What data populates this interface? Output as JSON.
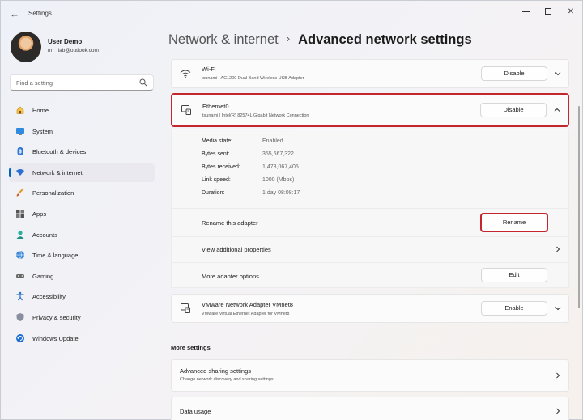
{
  "window": {
    "title": "Settings"
  },
  "user": {
    "name": "User Demo",
    "email": "m__lab@outlook.com"
  },
  "search": {
    "placeholder": "Find a setting"
  },
  "nav": {
    "items": [
      {
        "label": "Home",
        "icon": "home-icon"
      },
      {
        "label": "System",
        "icon": "system-icon"
      },
      {
        "label": "Bluetooth & devices",
        "icon": "bluetooth-icon"
      },
      {
        "label": "Network & internet",
        "icon": "network-icon",
        "active": true
      },
      {
        "label": "Personalization",
        "icon": "brush-icon"
      },
      {
        "label": "Apps",
        "icon": "apps-icon"
      },
      {
        "label": "Accounts",
        "icon": "accounts-icon"
      },
      {
        "label": "Time & language",
        "icon": "globe-icon"
      },
      {
        "label": "Gaming",
        "icon": "gaming-icon"
      },
      {
        "label": "Accessibility",
        "icon": "accessibility-icon"
      },
      {
        "label": "Privacy & security",
        "icon": "shield-icon"
      },
      {
        "label": "Windows Update",
        "icon": "update-icon"
      }
    ]
  },
  "breadcrumb": {
    "parent": "Network & internet",
    "separator": "›",
    "current": "Advanced network settings"
  },
  "adapters": {
    "wifi": {
      "title": "Wi-Fi",
      "subtitle": "tsunami | AC1200  Dual Band Wireless USB Adapter",
      "button": "Disable"
    },
    "ethernet": {
      "title": "Ethernet0",
      "subtitle": "tsunami | Intel(R) 82574L Gigabit Network Connection",
      "button": "Disable"
    },
    "vmware": {
      "title": "VMware Network Adapter VMnet8",
      "subtitle": "VMware Virtual Ethernet Adapter for VMnet8",
      "button": "Enable"
    }
  },
  "details": {
    "media_state": {
      "key": "Media state:",
      "value": "Enabled"
    },
    "bytes_sent": {
      "key": "Bytes sent:",
      "value": "355,667,322"
    },
    "bytes_received": {
      "key": "Bytes received:",
      "value": "1,478,067,405"
    },
    "link_speed": {
      "key": "Link speed:",
      "value": "1000 (Mbps)"
    },
    "duration": {
      "key": "Duration:",
      "value": "1 day 08:08:17"
    },
    "rename": {
      "label": "Rename this adapter",
      "button": "Rename"
    },
    "view_props": {
      "label": "View additional properties"
    },
    "more_options": {
      "label": "More adapter options",
      "button": "Edit"
    }
  },
  "more_settings": {
    "title": "More settings",
    "sharing": {
      "title": "Advanced sharing settings",
      "subtitle": "Change network discovery and sharing settings"
    },
    "data_usage": {
      "title": "Data usage"
    }
  },
  "colors": {
    "accent": "#0067c0",
    "highlight_border": "#c4262e"
  }
}
